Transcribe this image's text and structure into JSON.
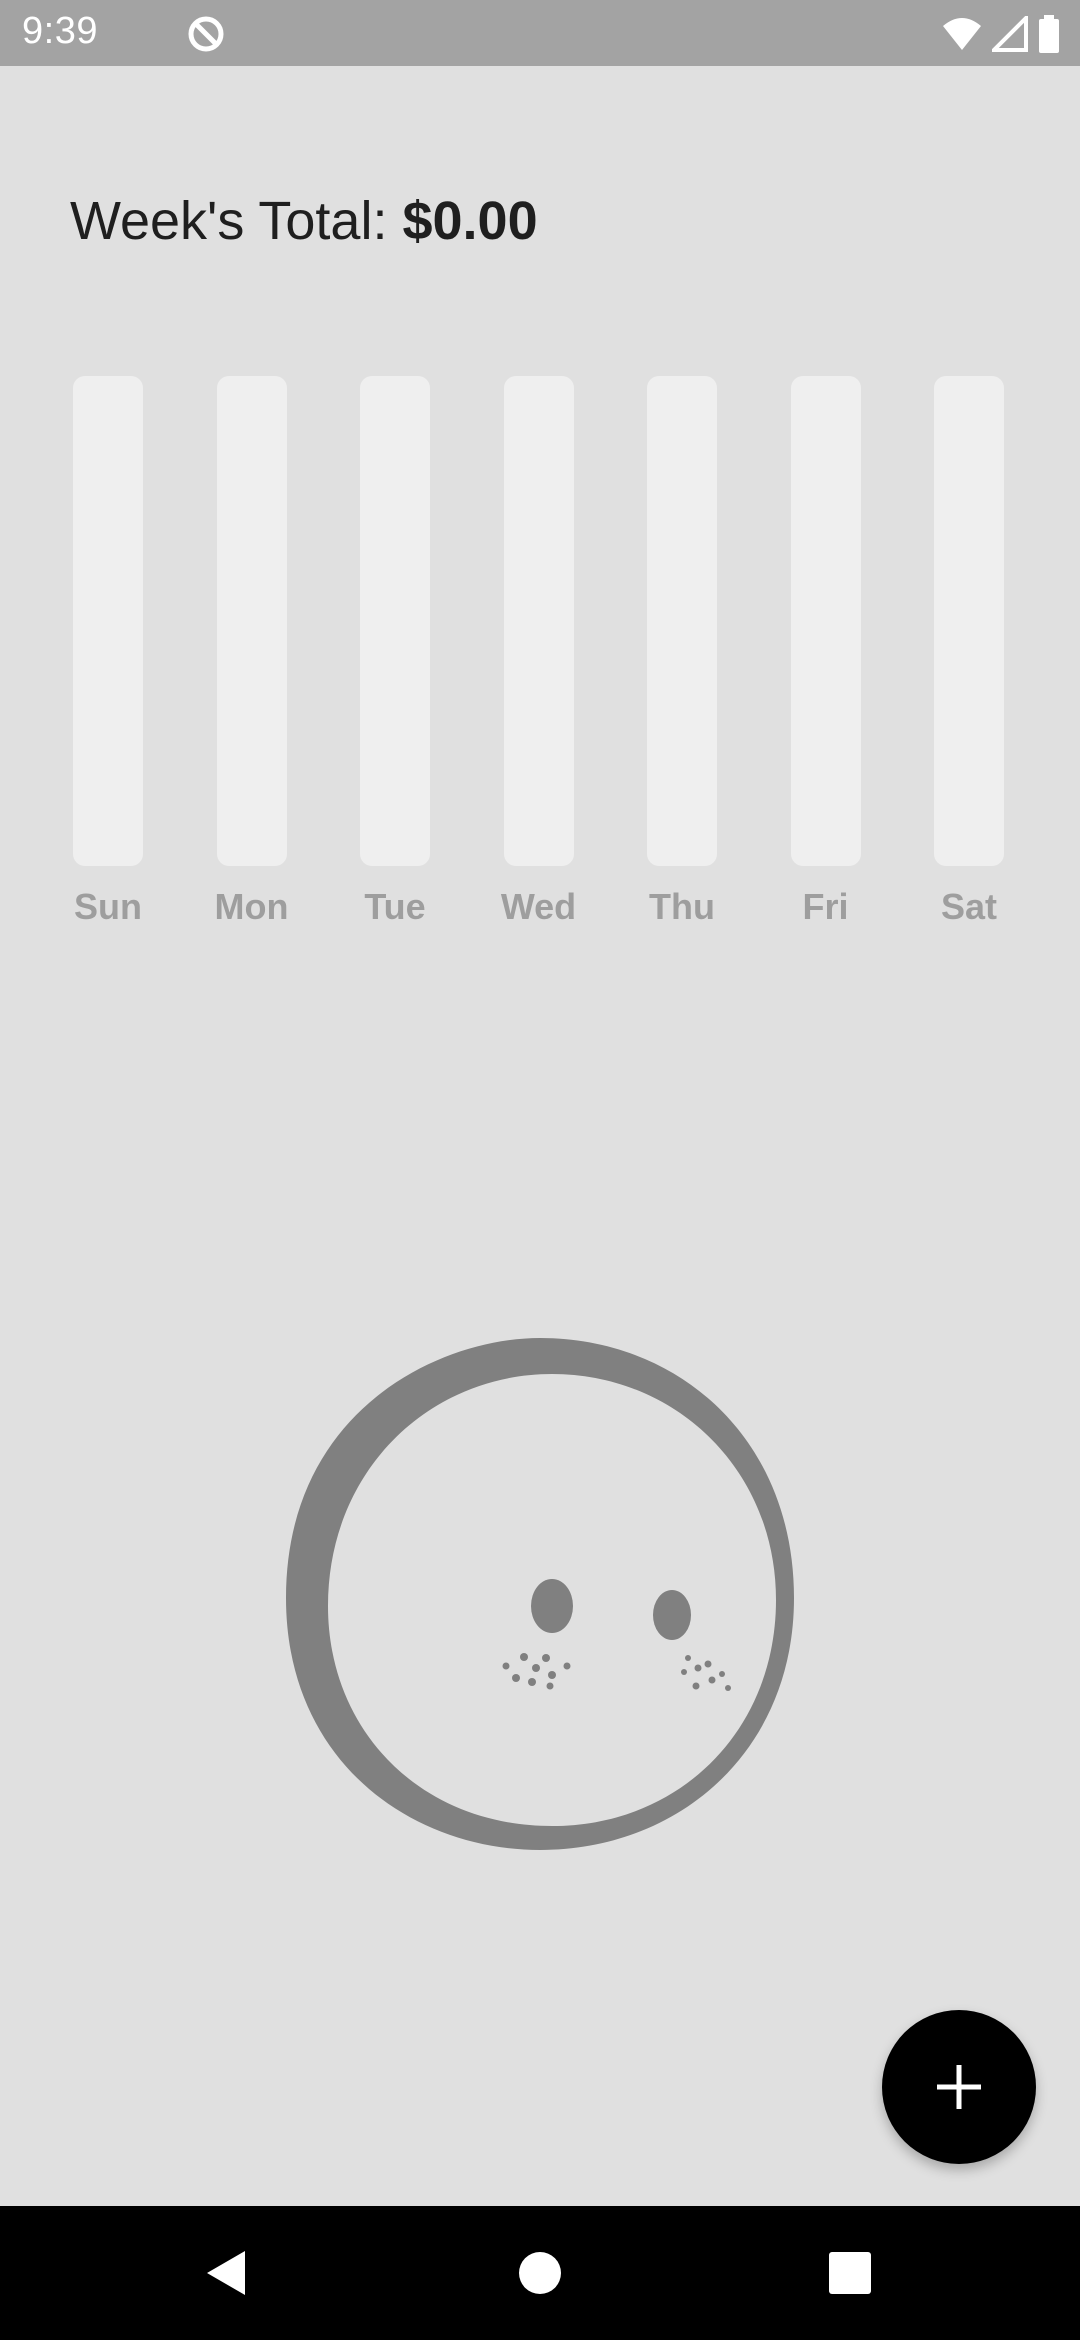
{
  "status_bar": {
    "time": "9:39",
    "icons": [
      "app-notification-icon",
      "wifi-icon",
      "cellular-signal-icon",
      "battery-icon"
    ]
  },
  "header": {
    "label": "Week's Total:",
    "amount": "$0.00"
  },
  "chart_data": {
    "type": "bar",
    "categories": [
      "Sun",
      "Mon",
      "Tue",
      "Wed",
      "Thu",
      "Fri",
      "Sat"
    ],
    "values": [
      0,
      0,
      0,
      0,
      0,
      0,
      0
    ]
  },
  "fab": {
    "icon": "plus-icon"
  },
  "nav_bar": {
    "buttons": [
      "back-icon",
      "home-icon",
      "recents-icon"
    ]
  },
  "colors": {
    "background": "#e0e0e0",
    "bar_track": "#efefef",
    "label": "#9e9e9e",
    "illustration": "#808080",
    "fab": "#000000"
  }
}
